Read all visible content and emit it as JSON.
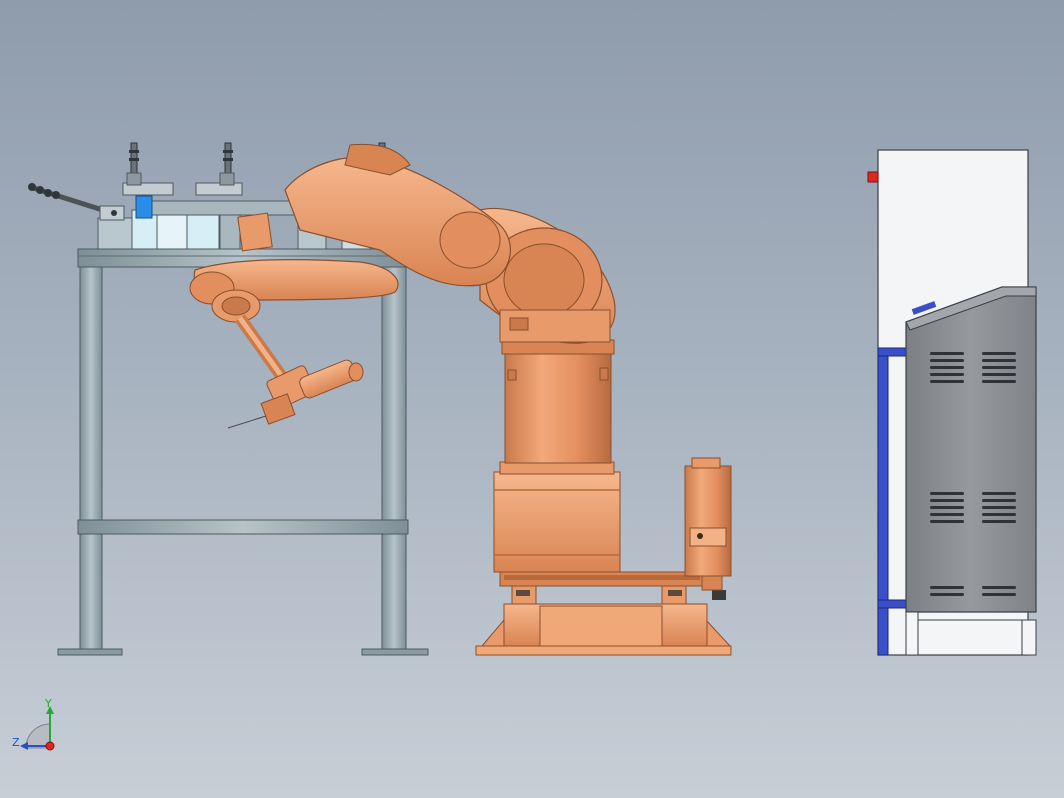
{
  "view": {
    "background_top": "#8f9cac",
    "background_bottom": "#c7ced6"
  },
  "colors": {
    "robot_orange": "#e89a6a",
    "robot_orange_dark": "#c9794b",
    "robot_orange_light": "#f6b78d",
    "frame_gray": "#9fb0b8",
    "frame_dark": "#6d7c84",
    "cabinet_gray": "#8b8f93",
    "cabinet_white": "#f4f5f7",
    "cabinet_blue": "#3a4fc8",
    "indicator_red": "#e0261f",
    "fixture_blue": "#2a8ee8",
    "fixture_light": "#d8eef6"
  },
  "triad": {
    "y_label": "Y",
    "z_label": "Z",
    "y_color": "#25a83a",
    "z_color": "#2550c8",
    "x_color": "#e0261f"
  }
}
